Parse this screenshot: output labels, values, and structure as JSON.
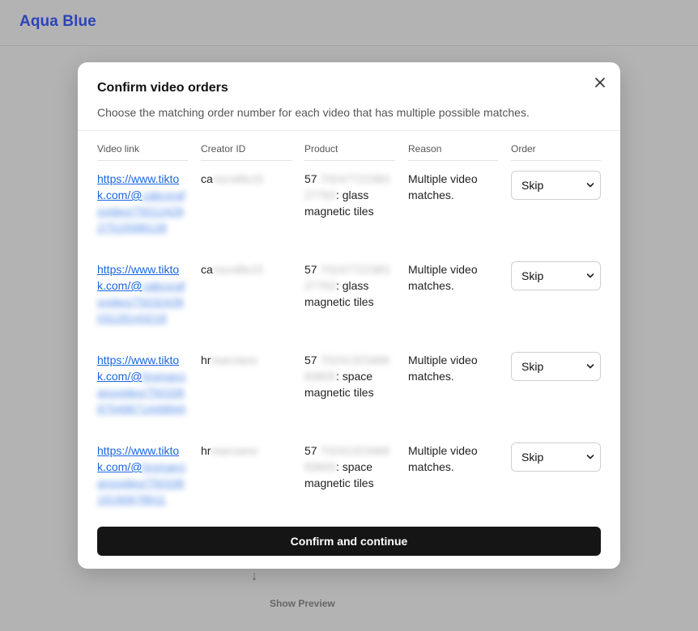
{
  "app": {
    "brand": "Aqua Blue"
  },
  "background": {
    "arrow": "↓",
    "preview_label": "Show Preview"
  },
  "modal": {
    "title": "Confirm video orders",
    "description": "Choose the matching order number for each video that has multiple possible matches.",
    "columns": [
      "Video link",
      "Creator ID",
      "Product",
      "Reason",
      "Order"
    ],
    "rows": [
      {
        "link_visible": "https://www.tiktok.com/@",
        "link_hidden": "cabcxrafsvideo/7501242827515588128",
        "creator_visible": "ca",
        "creator_hidden": "rocrafts15",
        "product_visible": "57",
        "product_hidden": "70247722383 27763",
        "product_name": ": glass magnetic tiles",
        "reason": "Multiple video matches.",
        "order": "Skip"
      },
      {
        "link_visible": "https://www.tiktok.com/@",
        "link_hidden": "cabcxrafsvideo/7503243903126143218",
        "creator_visible": "ca",
        "creator_hidden": "rocrafts15",
        "product_visible": "57",
        "product_hidden": "70247722383 27763",
        "product_name": ": glass magnetic tiles",
        "reason": "Multiple video matches.",
        "order": "Skip"
      },
      {
        "link_visible": "https://www.tiktok.com/@",
        "link_hidden": "hrsmarcianovideo/75033987549671449844",
        "creator_visible": "hr",
        "creator_hidden": "marciano",
        "product_visible": "57",
        "product_hidden": "70241323466 83600",
        "product_name": ": space magnetic tiles",
        "reason": "Multiple video matches.",
        "order": "Skip"
      },
      {
        "link_visible": "https://www.tiktok.com/@",
        "link_hidden": "hrsmarcianovideo/75033819190678611",
        "creator_visible": "hr",
        "creator_hidden": "marciano",
        "product_visible": "57",
        "product_hidden": "70241323466 83600",
        "product_name": ": space magnetic tiles",
        "reason": "Multiple video matches.",
        "order": "Skip"
      }
    ],
    "confirm_label": "Confirm and continue"
  },
  "icons": {
    "close": "close-icon",
    "select": "chevron-down-icon"
  }
}
